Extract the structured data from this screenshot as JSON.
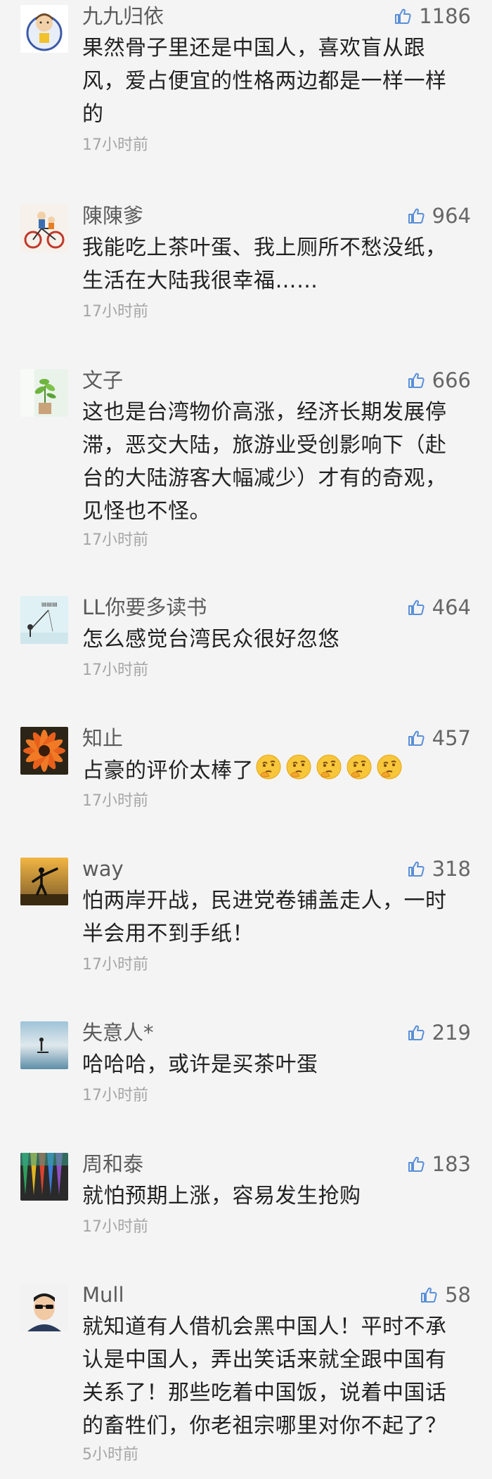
{
  "comments": [
    {
      "user": "九九归依",
      "likes": "1186",
      "text": "果然骨子里还是中国人，喜欢盲从跟风，爱占便宜的性格两边都是一样一样的",
      "time": "17小时前",
      "avatar": "boy-avatar-icon"
    },
    {
      "user": "陳陳爹",
      "likes": "964",
      "text": "我能吃上茶叶蛋、我上厕所不愁没纸，生活在大陆我很幸福……",
      "time": "17小时前",
      "avatar": "bicycle-avatar-icon"
    },
    {
      "user": "文子",
      "likes": "666",
      "text": "这也是台湾物价高涨，经济长期发展停滞，恶交大陆，旅游业受创影响下（赴台的大陆游客大幅减少）才有的奇观，见怪也不怪。",
      "time": "17小时前",
      "avatar": "plant-avatar-icon"
    },
    {
      "user": "LL你要多读书",
      "likes": "464",
      "text": "怎么感觉台湾民众很好忽悠",
      "time": "17小时前",
      "avatar": "fishing-avatar-icon"
    },
    {
      "user": "知止",
      "likes": "457",
      "text": "占豪的评价太棒了",
      "time": "17小时前",
      "avatar": "flower-avatar-icon",
      "emoji": "thinking-face-icon",
      "emoji_count": 5
    },
    {
      "user": "way",
      "likes": "318",
      "text": "怕两岸开战，民进党卷铺盖走人，一时半会用不到手纸！",
      "time": "17小时前",
      "avatar": "kick-silhouette-avatar-icon"
    },
    {
      "user": "失意人*",
      "likes": "219",
      "text": "哈哈哈，或许是买茶叶蛋",
      "time": "17小时前",
      "avatar": "lake-avatar-icon"
    },
    {
      "user": "周和泰",
      "likes": "183",
      "text": "就怕预期上涨，容易发生抢购",
      "time": "17小时前",
      "avatar": "colored-pencils-avatar-icon"
    },
    {
      "user": "Mull",
      "likes": "58",
      "text": "就知道有人借机会黑中国人！平时不承认是中国人，弄出笑话来就全跟中国有关系了！那些吃着中国饭，说着中国话的畜牲们，你老祖宗哪里对你不起了？",
      "time": "5小时前",
      "avatar": "man-sunglasses-avatar-icon"
    }
  ],
  "icons": {
    "like": "thumbs-up-icon"
  },
  "colors": {
    "background": "#f4f4f4",
    "username": "#5b5b5b",
    "timestamp": "#a5a5a5",
    "like_icon": "#5a8fd8"
  }
}
